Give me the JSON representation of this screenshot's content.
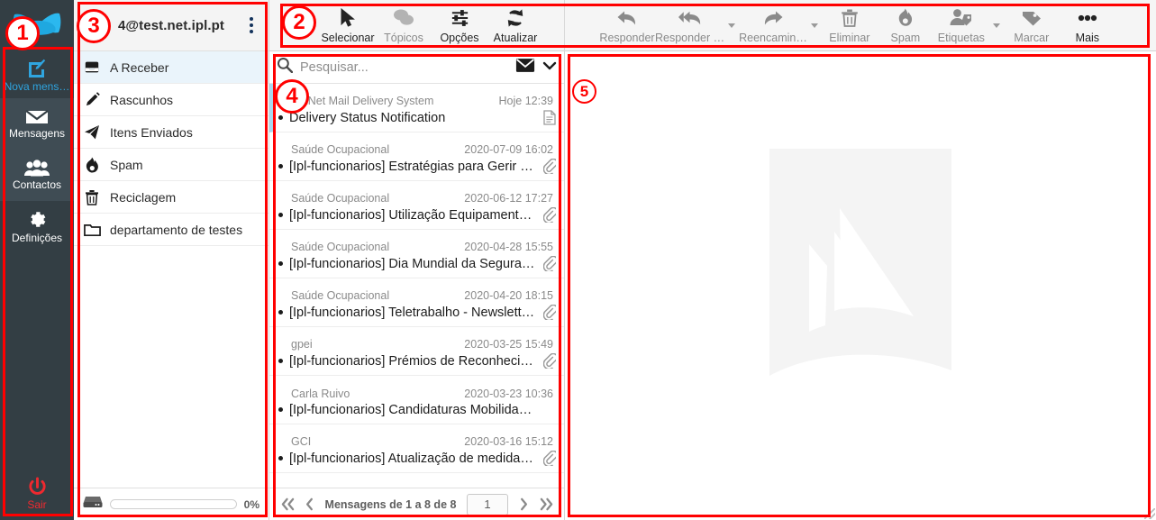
{
  "rail": {
    "logo_icon": "propeller-logo",
    "items": [
      {
        "id": "compose",
        "label": "Nova mens…",
        "icon": "compose-pencil-icon"
      },
      {
        "id": "messages",
        "label": "Mensagens",
        "icon": "envelope-icon"
      },
      {
        "id": "contacts",
        "label": "Contactos",
        "icon": "people-icon"
      },
      {
        "id": "settings",
        "label": "Definições",
        "icon": "gear-icon"
      }
    ],
    "logout": {
      "label": "Sair",
      "icon": "power-icon"
    }
  },
  "folders": {
    "account": "4@test.net.ipl.pt",
    "menu_icon": "kebab-menu-icon",
    "items": [
      {
        "label": "A Receber",
        "icon": "inbox-icon",
        "selected": true
      },
      {
        "label": "Rascunhos",
        "icon": "pencil-icon",
        "selected": false
      },
      {
        "label": "Itens Enviados",
        "icon": "paper-plane-icon",
        "selected": false
      },
      {
        "label": "Spam",
        "icon": "flame-icon",
        "selected": false
      },
      {
        "label": "Reciclagem",
        "icon": "trash-icon",
        "selected": false
      },
      {
        "label": "departamento de testes",
        "icon": "folder-icon",
        "selected": false
      }
    ],
    "quota": {
      "icon": "disk-icon",
      "percent": "0%",
      "value": 0
    }
  },
  "toolbar": {
    "left": [
      {
        "label": "Selecionar",
        "icon": "cursor-arrow-icon",
        "enabled": true,
        "caret": false
      },
      {
        "label": "Tópicos",
        "icon": "threads-bubbles-icon",
        "enabled": false,
        "caret": false
      },
      {
        "label": "Opções",
        "icon": "sliders-icon",
        "enabled": true,
        "caret": false
      },
      {
        "label": "Atualizar",
        "icon": "refresh-icon",
        "enabled": true,
        "caret": false
      }
    ],
    "right": [
      {
        "label": "Responder",
        "icon": "reply-icon",
        "enabled": false,
        "caret": false
      },
      {
        "label": "Responder …",
        "icon": "reply-all-icon",
        "enabled": false,
        "caret": true
      },
      {
        "label": "Reencamin…",
        "icon": "forward-icon",
        "enabled": false,
        "caret": true
      },
      {
        "label": "Eliminar",
        "icon": "trash-icon",
        "enabled": false,
        "caret": false
      },
      {
        "label": "Spam",
        "icon": "flame-icon",
        "enabled": false,
        "caret": false
      },
      {
        "label": "Etiquetas",
        "icon": "tag-person-icon",
        "enabled": false,
        "caret": true
      },
      {
        "label": "Marcar",
        "icon": "label-tag-icon",
        "enabled": false,
        "caret": false
      },
      {
        "label": "Mais",
        "icon": "ellipsis-icon",
        "enabled": true,
        "caret": false
      }
    ]
  },
  "search": {
    "placeholder": "Pesquisar...",
    "value": "",
    "icon": "search-icon",
    "scope_icon": "envelope-icon",
    "caret_icon": "chevron-down-icon"
  },
  "messages": [
    {
      "from": "IPLNet Mail Delivery System",
      "date": "Hoje 12:39",
      "subject": "Delivery Status Notification",
      "unread": true,
      "attachment": "document-icon",
      "selected": true
    },
    {
      "from": "Saúde Ocupacional",
      "date": "2020-07-09 16:02",
      "subject": "[Ipl-funcionarios] Estratégias para Gerir a…",
      "unread": true,
      "attachment": "paperclip-icon",
      "selected": false
    },
    {
      "from": "Saúde Ocupacional",
      "date": "2020-06-12 17:27",
      "subject": "[Ipl-funcionarios] Utilização Equipamento…",
      "unread": true,
      "attachment": "paperclip-icon",
      "selected": false
    },
    {
      "from": "Saúde Ocupacional",
      "date": "2020-04-28 15:55",
      "subject": "[Ipl-funcionarios] Dia Mundial da Seguran…",
      "unread": true,
      "attachment": "paperclip-icon",
      "selected": false
    },
    {
      "from": "Saúde Ocupacional",
      "date": "2020-04-20 18:15",
      "subject": "[Ipl-funcionarios] Teletrabalho - Newslett…",
      "unread": true,
      "attachment": "paperclip-icon",
      "selected": false
    },
    {
      "from": "gpei",
      "date": "2020-03-25 15:49",
      "subject": "[Ipl-funcionarios] Prémios de Reconheci…",
      "unread": true,
      "attachment": "paperclip-icon",
      "selected": false
    },
    {
      "from": "Carla Ruivo",
      "date": "2020-03-23 10:36",
      "subject": "[Ipl-funcionarios] Candidaturas Mobilida…",
      "unread": true,
      "attachment": "",
      "selected": false
    },
    {
      "from": "GCI",
      "date": "2020-03-16 15:12",
      "subject": "[Ipl-funcionarios] Atualização de medida…",
      "unread": true,
      "attachment": "paperclip-icon",
      "selected": false
    }
  ],
  "pager": {
    "first_icon": "double-chevron-left-icon",
    "prev_icon": "chevron-left-icon",
    "info": "Mensagens de 1 a 8 de 8",
    "page": "1",
    "next_icon": "chevron-right-icon",
    "last_icon": "double-chevron-right-icon"
  },
  "reading_pane": {
    "watermark_icon": "sail-watermark",
    "content": ""
  },
  "annotations": [
    {
      "id": "1",
      "target": "left-rail"
    },
    {
      "id": "2",
      "target": "toolbar"
    },
    {
      "id": "3",
      "target": "folders-panel"
    },
    {
      "id": "4",
      "target": "message-list"
    },
    {
      "id": "5",
      "target": "reading-pane"
    }
  ],
  "colors": {
    "rail_bg": "#333e44",
    "rail_active_bg": "#3f4c54",
    "accent_blue": "#2fa5e0",
    "logout_red": "#f0292f",
    "annotation_red": "#ff0000",
    "folder_selected_bg": "#eaf4fb",
    "toolbar_bg": "#f5f5f5"
  }
}
